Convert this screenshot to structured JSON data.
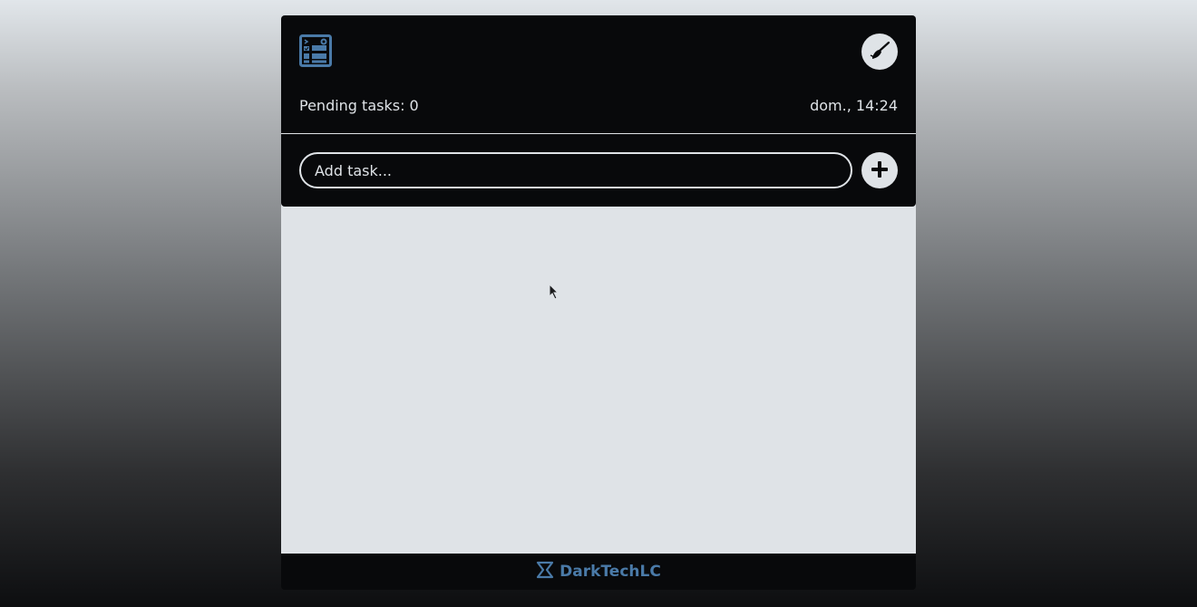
{
  "header": {
    "logo_icon": "task-list-logo-icon",
    "clean_icon": "broom-icon",
    "pending_label": "Pending tasks: 0",
    "datetime": "dom., 14:24"
  },
  "add_task": {
    "placeholder": "Add task...",
    "value": "",
    "add_icon": "plus-icon"
  },
  "tasks": [],
  "footer": {
    "brand_icon": "chevron-logo-icon",
    "brand_name": "DarkTechLC"
  },
  "colors": {
    "panel": "#08090b",
    "light": "#dfe3e7",
    "accent": "#4a7aa8"
  }
}
